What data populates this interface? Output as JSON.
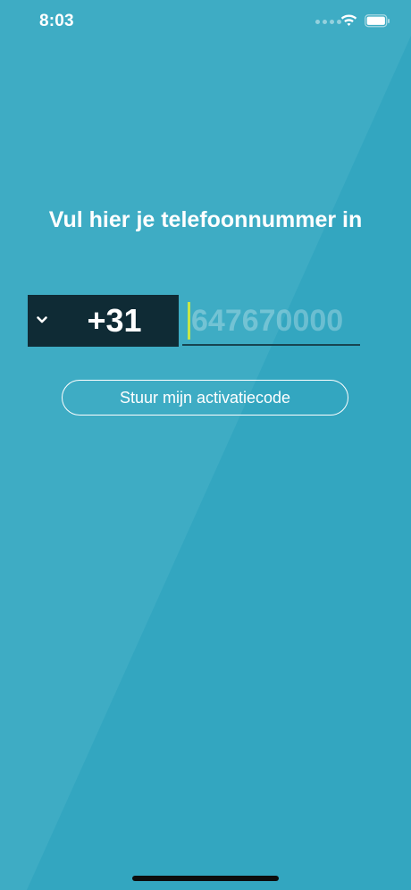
{
  "status_bar": {
    "time": "8:03",
    "icons": [
      "cellular-signal-icon",
      "wifi-icon",
      "battery-icon"
    ]
  },
  "colors": {
    "background": "#33a6c0",
    "background_light": "#3eacc4",
    "selector_bg": "#0f2b35",
    "cursor": "#c6e64a",
    "text": "#ffffff"
  },
  "main": {
    "title": "Vul hier je telefoonnummer in",
    "country_selector": {
      "code": "+31",
      "icon": "chevron-down-icon"
    },
    "phone_input": {
      "value": "",
      "placeholder": "647670000"
    },
    "submit_button": {
      "label": "Stuur mijn activatiecode"
    }
  }
}
